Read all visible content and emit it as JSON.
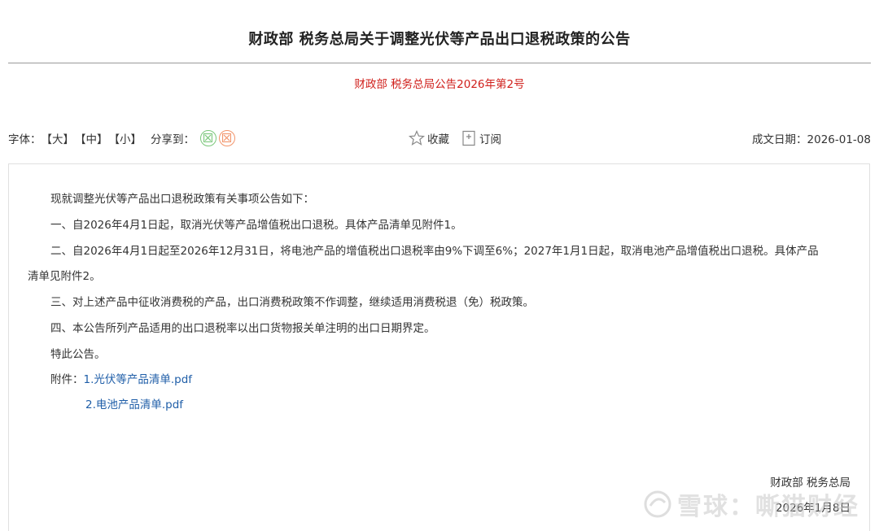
{
  "header": {
    "title": "财政部 税务总局关于调整光伏等产品出口退税政策的公告",
    "doc_number": "财政部 税务总局公告2026年第2号"
  },
  "toolbar": {
    "font_label": "字体：",
    "size_large": "【大】",
    "size_medium": "【中】",
    "size_small": "【小】",
    "share_label": "分享到：",
    "share_icons": [
      "share-green-icon",
      "share-orange-icon"
    ],
    "favorite_label": "收藏",
    "subscribe_label": "订阅",
    "date_label": "成文日期：2026-01-08"
  },
  "content": {
    "intro": "现就调整光伏等产品出口退税政策有关事项公告如下：",
    "item1": "一、自2026年4月1日起，取消光伏等产品增值税出口退税。具体产品清单见附件1。",
    "item2_line1": "二、自2026年4月1日起至2026年12月31日，将电池产品的增值税出口退税率由9%下调至6%；2027年1月1日起，取消电池产品增值税出口退税。具体产品",
    "item2_line2": "清单见附件2。",
    "item3": "三、对上述产品中征收消费税的产品，出口消费税政策不作调整，继续适用消费税退（免）税政策。",
    "item4": "四、本公告所列产品适用的出口退税率以出口货物报关单注明的出口日期界定。",
    "closing": "特此公告。",
    "attachments_label": "附件：",
    "attachment1": "1.光伏等产品清单.pdf",
    "attachment2": "2.电池产品清单.pdf"
  },
  "signature": {
    "issuer": "财政部 税务总局",
    "date": "2026年1月8日"
  },
  "watermark": {
    "text": "雪球：嘶猫财经"
  },
  "colors": {
    "doc_number": "#d0201c",
    "link": "#1f5ea8",
    "share_green": "#7bc77b",
    "share_orange": "#f2956b"
  }
}
